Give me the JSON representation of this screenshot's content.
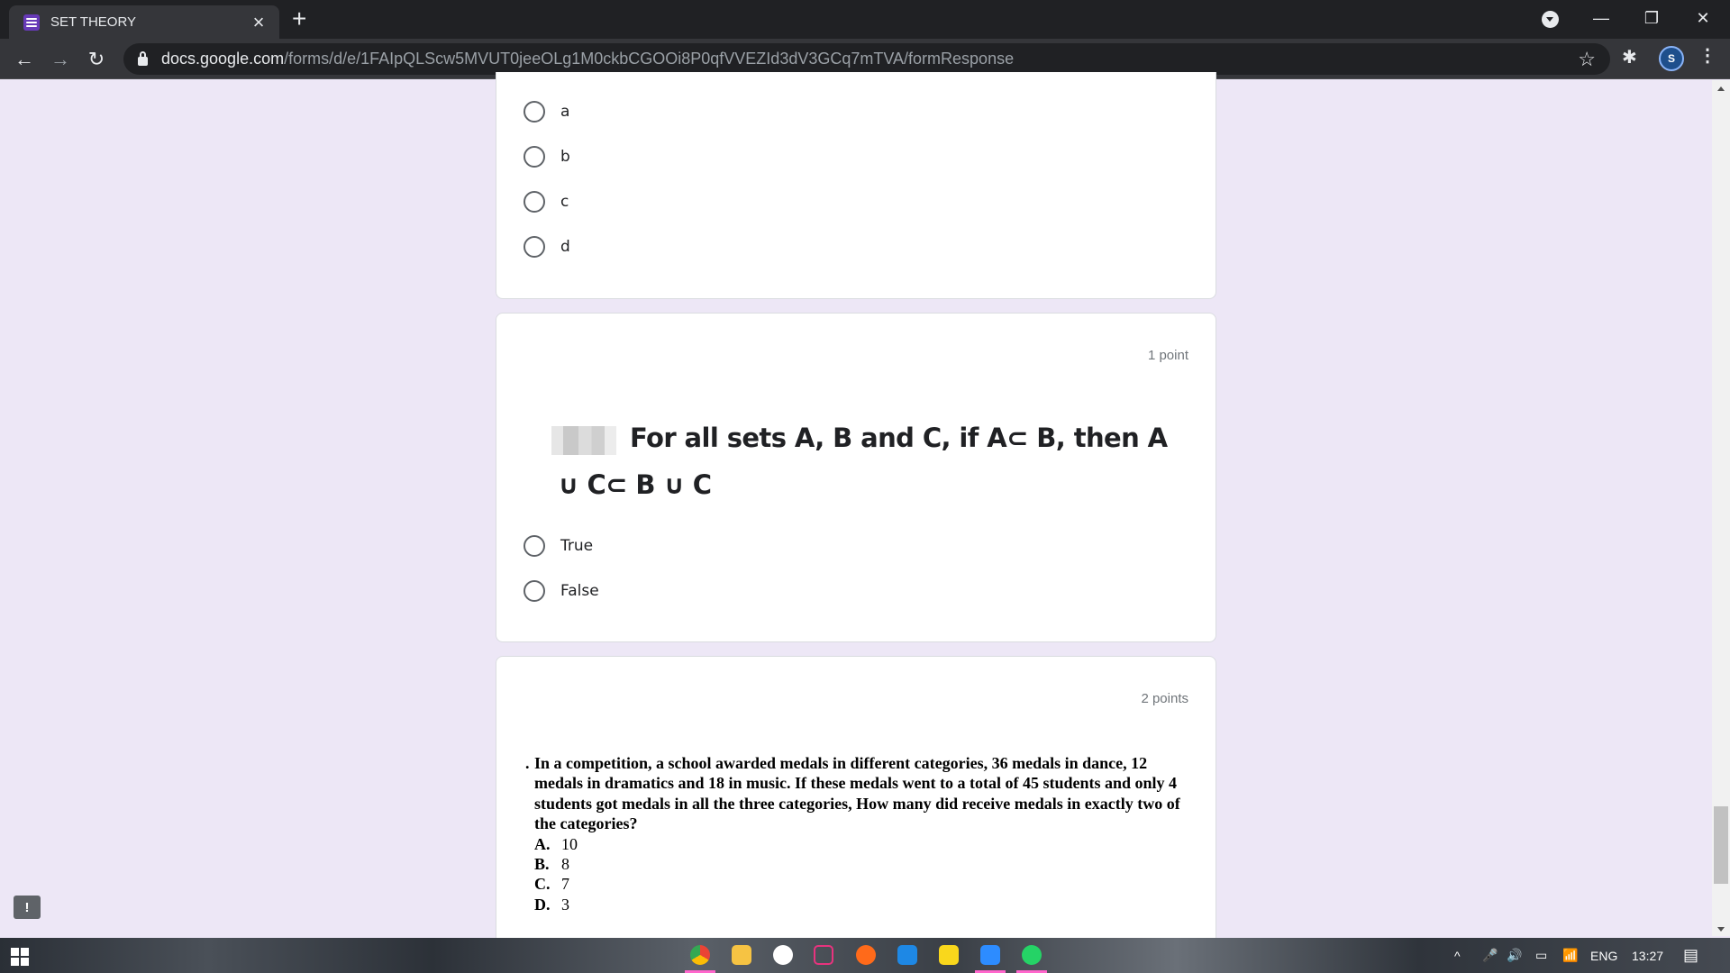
{
  "browser": {
    "tab_title": "SET THEORY",
    "url_host": "docs.google.com",
    "url_path": "/forms/d/e/1FAIpQLScw5MVUT0jeeOLg1M0ckbCGOOi8P0qfVVEZId3dV3GCq7mTVA/formResponse"
  },
  "icons": {
    "tab_close": "×",
    "new_tab": "+",
    "minimize": "—",
    "restore": "❐",
    "close": "✕",
    "back": "←",
    "forward": "→",
    "reload": "↻",
    "bookmark": "☆",
    "extensions": "✱",
    "menu": "⋮",
    "feedback": "!",
    "profile": "S"
  },
  "question_1": {
    "options": [
      "a",
      "b",
      "c",
      "d"
    ]
  },
  "question_2": {
    "points": "1 point",
    "title": "For all sets A, B and C, if A⊂ B, then A ∪ C⊂ B ∪ C",
    "options": [
      "True",
      "False"
    ]
  },
  "question_3": {
    "points": "2 points",
    "dot": ".",
    "text": "In a competition, a school awarded medals in different categories, 36 medals in dance, 12 medals in dramatics and 18 in music. If these medals went to a total of 45 students and only 4 students got medals in all the three categories, How many did receive medals in exactly two of the categories?",
    "answers": [
      {
        "letter": "A.",
        "value": "10"
      },
      {
        "letter": "B.",
        "value": "8"
      },
      {
        "letter": "C.",
        "value": "7"
      },
      {
        "letter": "D.",
        "value": "3"
      }
    ]
  },
  "taskbar": {
    "tray_language": "ENG",
    "clock": "13:27",
    "tray_icons": [
      "^",
      "🎤",
      "🔊",
      "▭",
      "📶"
    ]
  }
}
